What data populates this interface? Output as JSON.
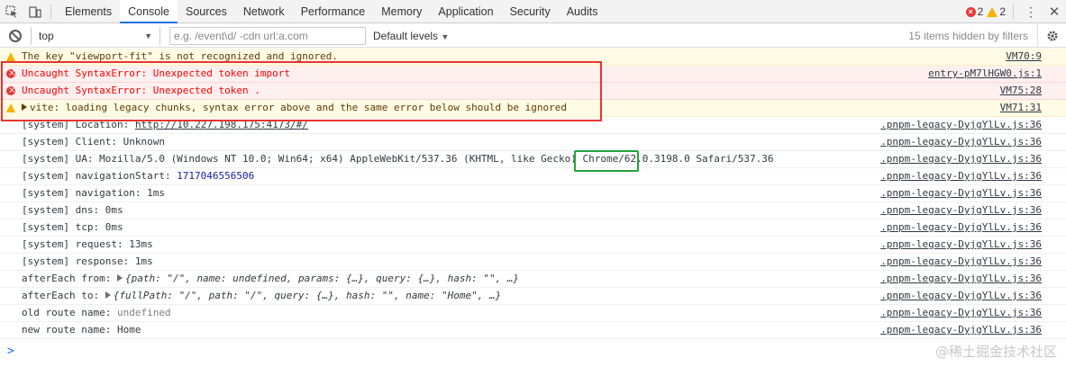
{
  "tabs": [
    "Elements",
    "Console",
    "Sources",
    "Network",
    "Performance",
    "Memory",
    "Application",
    "Security",
    "Audits"
  ],
  "active_tab": "Console",
  "counts": {
    "errors": "2",
    "warnings": "2"
  },
  "toolbar": {
    "context": "top",
    "filter_placeholder": "e.g. /event\\d/ -cdn url:a.com",
    "levels": "Default levels",
    "hidden": "15 items hidden by filters"
  },
  "messages": [
    {
      "type": "warn",
      "text": "The key \"viewport-fit\" is not recognized and ignored.",
      "source": "VM70:9"
    },
    {
      "type": "error",
      "text": "Uncaught SyntaxError: Unexpected token import",
      "source": "entry-pM7lHGW0.js:1"
    },
    {
      "type": "error",
      "text": "Uncaught SyntaxError: Unexpected token .",
      "source": "VM75:28"
    },
    {
      "type": "warn",
      "text": "vite: loading legacy chunks, syntax error above and the same error below should be ignored",
      "source": "VM71:31"
    },
    {
      "type": "log",
      "prefix": "[system] Location: ",
      "link": "http://10.227.198.175:4173/#/",
      "source": ".pnpm-legacy-DyjgYlLv.js:36"
    },
    {
      "type": "log",
      "text": "[system] Client: Unknown",
      "source": ".pnpm-legacy-DyjgYlLv.js:36"
    },
    {
      "type": "log",
      "text": "[system] UA: Mozilla/5.0 (Windows NT 10.0; Win64; x64) AppleWebKit/537.36 (KHTML, like Gecko) Chrome/62.0.3198.0 Safari/537.36",
      "source": ".pnpm-legacy-DyjgYlLv.js:36"
    },
    {
      "type": "log",
      "prefix": "[system] navigationStart: ",
      "number": "1717046556506",
      "source": ".pnpm-legacy-DyjgYlLv.js:36"
    },
    {
      "type": "log",
      "text": "[system] navigation: 1ms",
      "source": ".pnpm-legacy-DyjgYlLv.js:36"
    },
    {
      "type": "log",
      "text": "[system] dns: 0ms",
      "source": ".pnpm-legacy-DyjgYlLv.js:36"
    },
    {
      "type": "log",
      "text": "[system] tcp: 0ms",
      "source": ".pnpm-legacy-DyjgYlLv.js:36"
    },
    {
      "type": "log",
      "text": "[system] request: 13ms",
      "source": ".pnpm-legacy-DyjgYlLv.js:36"
    },
    {
      "type": "log",
      "text": "[system] response: 1ms",
      "source": ".pnpm-legacy-DyjgYlLv.js:36"
    },
    {
      "type": "log",
      "prefix": "afterEach from: ",
      "object": "{path: \"/\", name: undefined, params: {…}, query: {…}, hash: \"\", …}",
      "source": ".pnpm-legacy-DyjgYlLv.js:36"
    },
    {
      "type": "log",
      "prefix": "afterEach to: ",
      "object": "{fullPath: \"/\", path: \"/\", query: {…}, hash: \"\", name: \"Home\", …}",
      "source": ".pnpm-legacy-DyjgYlLv.js:36"
    },
    {
      "type": "log",
      "prefix": "old route name: ",
      "grey": "undefined",
      "source": ".pnpm-legacy-DyjgYlLv.js:36"
    },
    {
      "type": "log",
      "prefix": "new route name: ",
      "plain": "Home",
      "source": ".pnpm-legacy-DyjgYlLv.js:36"
    }
  ],
  "prompt": ">",
  "watermark": "@稀土掘金技术社区",
  "colors": {
    "accent": "#1a73e8",
    "error": "#e53935",
    "warning": "#f3b300",
    "highlight_red": "#e8352e",
    "highlight_green": "#22a33a"
  }
}
